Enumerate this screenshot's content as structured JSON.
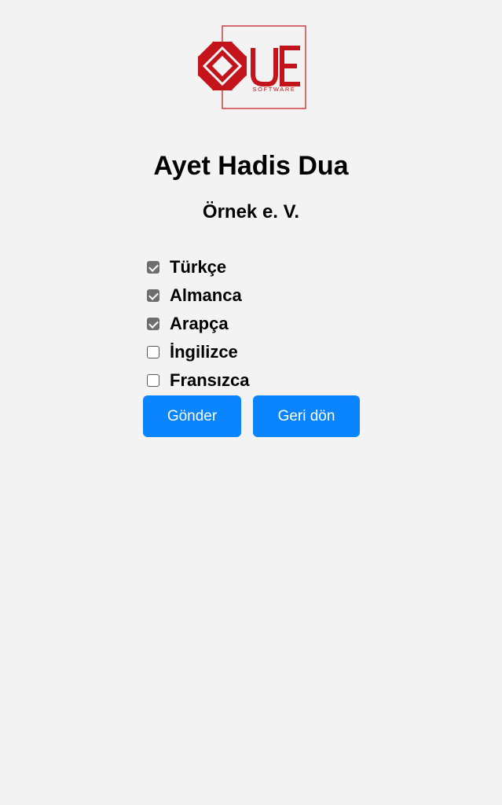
{
  "logo": {
    "letters": "UE",
    "tagline": "SOFTWARE",
    "color": "#c3141b"
  },
  "header": {
    "title": "Ayet Hadis Dua",
    "subtitle": "Örnek e. V."
  },
  "languages": [
    {
      "label": "Türkçe",
      "checked": true
    },
    {
      "label": "Almanca",
      "checked": true
    },
    {
      "label": "Arapça",
      "checked": true
    },
    {
      "label": "İngilizce",
      "checked": false
    },
    {
      "label": "Fransızca",
      "checked": false
    }
  ],
  "actions": {
    "send_label": "Gönder",
    "back_label": "Geri dön",
    "button_color": "#0a84ff"
  }
}
